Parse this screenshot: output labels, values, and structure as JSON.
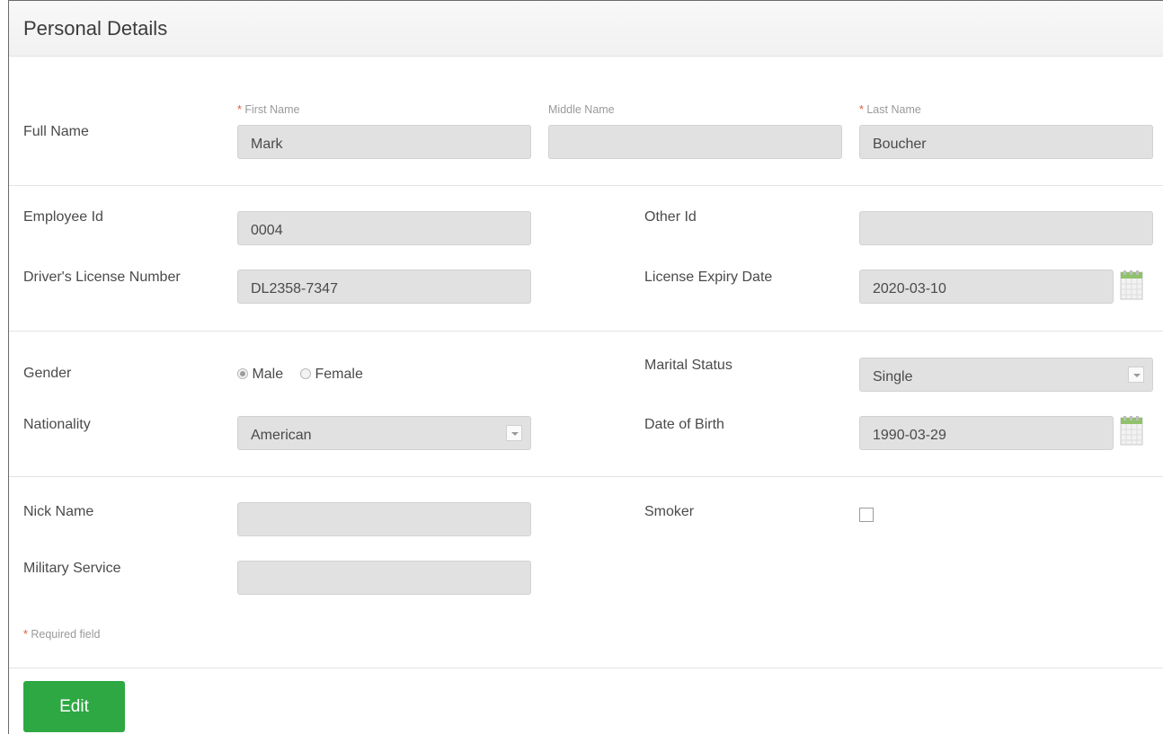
{
  "section": {
    "title": "Personal Details"
  },
  "full_name": {
    "label": "Full Name",
    "first": {
      "required_mark": "*",
      "label": "First Name",
      "value": "Mark"
    },
    "middle": {
      "label": "Middle Name",
      "value": ""
    },
    "last": {
      "required_mark": "*",
      "label": "Last Name",
      "value": "Boucher"
    }
  },
  "ids": {
    "employee_id": {
      "label": "Employee Id",
      "value": "0004"
    },
    "other_id": {
      "label": "Other Id",
      "value": ""
    },
    "license_number": {
      "label": "Driver's License Number",
      "value": "DL2358-7347"
    },
    "license_expiry": {
      "label": "License Expiry Date",
      "value": "2020-03-10",
      "icon": "calendar-icon"
    }
  },
  "demographics": {
    "gender": {
      "label": "Gender",
      "options": [
        "Male",
        "Female"
      ],
      "selected": "Male"
    },
    "marital_status": {
      "label": "Marital Status",
      "value": "Single"
    },
    "nationality": {
      "label": "Nationality",
      "value": "American"
    },
    "dob": {
      "label": "Date of Birth",
      "value": "1990-03-29",
      "icon": "calendar-icon"
    }
  },
  "other": {
    "nick_name": {
      "label": "Nick Name",
      "value": ""
    },
    "smoker": {
      "label": "Smoker",
      "checked": false
    },
    "military": {
      "label": "Military Service",
      "value": ""
    }
  },
  "footer": {
    "required_mark": "*",
    "required_note": "Required field",
    "edit_label": "Edit"
  },
  "colors": {
    "accent": "#2ea843",
    "required": "#e25a3a",
    "field_bg": "#e1e1e1",
    "calendar": "#8fc26a"
  }
}
